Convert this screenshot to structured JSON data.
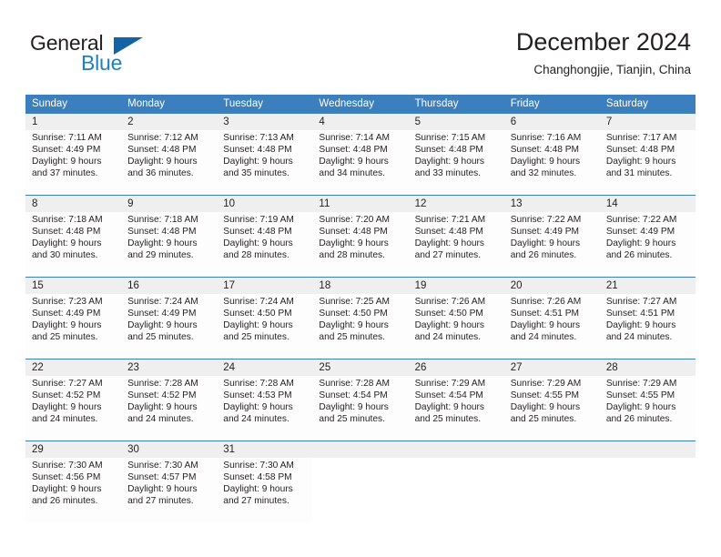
{
  "brand": {
    "name_part1": "General",
    "name_part2": "Blue"
  },
  "header": {
    "title": "December 2024",
    "location": "Changhongjie, Tianjin, China"
  },
  "colors": {
    "header_blue": "#3c7fbe",
    "brand_blue": "#1f7fc4",
    "logo_triangle": "#1464a5",
    "daynum_band": "#efefef",
    "text": "#231f20"
  },
  "weekday_headers": [
    "Sunday",
    "Monday",
    "Tuesday",
    "Wednesday",
    "Thursday",
    "Friday",
    "Saturday"
  ],
  "weeks": [
    {
      "days": [
        {
          "num": "1",
          "sunrise": "Sunrise: 7:11 AM",
          "sunset": "Sunset: 4:49 PM",
          "daylight1": "Daylight: 9 hours",
          "daylight2": "and 37 minutes."
        },
        {
          "num": "2",
          "sunrise": "Sunrise: 7:12 AM",
          "sunset": "Sunset: 4:48 PM",
          "daylight1": "Daylight: 9 hours",
          "daylight2": "and 36 minutes."
        },
        {
          "num": "3",
          "sunrise": "Sunrise: 7:13 AM",
          "sunset": "Sunset: 4:48 PM",
          "daylight1": "Daylight: 9 hours",
          "daylight2": "and 35 minutes."
        },
        {
          "num": "4",
          "sunrise": "Sunrise: 7:14 AM",
          "sunset": "Sunset: 4:48 PM",
          "daylight1": "Daylight: 9 hours",
          "daylight2": "and 34 minutes."
        },
        {
          "num": "5",
          "sunrise": "Sunrise: 7:15 AM",
          "sunset": "Sunset: 4:48 PM",
          "daylight1": "Daylight: 9 hours",
          "daylight2": "and 33 minutes."
        },
        {
          "num": "6",
          "sunrise": "Sunrise: 7:16 AM",
          "sunset": "Sunset: 4:48 PM",
          "daylight1": "Daylight: 9 hours",
          "daylight2": "and 32 minutes."
        },
        {
          "num": "7",
          "sunrise": "Sunrise: 7:17 AM",
          "sunset": "Sunset: 4:48 PM",
          "daylight1": "Daylight: 9 hours",
          "daylight2": "and 31 minutes."
        }
      ]
    },
    {
      "days": [
        {
          "num": "8",
          "sunrise": "Sunrise: 7:18 AM",
          "sunset": "Sunset: 4:48 PM",
          "daylight1": "Daylight: 9 hours",
          "daylight2": "and 30 minutes."
        },
        {
          "num": "9",
          "sunrise": "Sunrise: 7:18 AM",
          "sunset": "Sunset: 4:48 PM",
          "daylight1": "Daylight: 9 hours",
          "daylight2": "and 29 minutes."
        },
        {
          "num": "10",
          "sunrise": "Sunrise: 7:19 AM",
          "sunset": "Sunset: 4:48 PM",
          "daylight1": "Daylight: 9 hours",
          "daylight2": "and 28 minutes."
        },
        {
          "num": "11",
          "sunrise": "Sunrise: 7:20 AM",
          "sunset": "Sunset: 4:48 PM",
          "daylight1": "Daylight: 9 hours",
          "daylight2": "and 28 minutes."
        },
        {
          "num": "12",
          "sunrise": "Sunrise: 7:21 AM",
          "sunset": "Sunset: 4:48 PM",
          "daylight1": "Daylight: 9 hours",
          "daylight2": "and 27 minutes."
        },
        {
          "num": "13",
          "sunrise": "Sunrise: 7:22 AM",
          "sunset": "Sunset: 4:49 PM",
          "daylight1": "Daylight: 9 hours",
          "daylight2": "and 26 minutes."
        },
        {
          "num": "14",
          "sunrise": "Sunrise: 7:22 AM",
          "sunset": "Sunset: 4:49 PM",
          "daylight1": "Daylight: 9 hours",
          "daylight2": "and 26 minutes."
        }
      ]
    },
    {
      "days": [
        {
          "num": "15",
          "sunrise": "Sunrise: 7:23 AM",
          "sunset": "Sunset: 4:49 PM",
          "daylight1": "Daylight: 9 hours",
          "daylight2": "and 25 minutes."
        },
        {
          "num": "16",
          "sunrise": "Sunrise: 7:24 AM",
          "sunset": "Sunset: 4:49 PM",
          "daylight1": "Daylight: 9 hours",
          "daylight2": "and 25 minutes."
        },
        {
          "num": "17",
          "sunrise": "Sunrise: 7:24 AM",
          "sunset": "Sunset: 4:50 PM",
          "daylight1": "Daylight: 9 hours",
          "daylight2": "and 25 minutes."
        },
        {
          "num": "18",
          "sunrise": "Sunrise: 7:25 AM",
          "sunset": "Sunset: 4:50 PM",
          "daylight1": "Daylight: 9 hours",
          "daylight2": "and 25 minutes."
        },
        {
          "num": "19",
          "sunrise": "Sunrise: 7:26 AM",
          "sunset": "Sunset: 4:50 PM",
          "daylight1": "Daylight: 9 hours",
          "daylight2": "and 24 minutes."
        },
        {
          "num": "20",
          "sunrise": "Sunrise: 7:26 AM",
          "sunset": "Sunset: 4:51 PM",
          "daylight1": "Daylight: 9 hours",
          "daylight2": "and 24 minutes."
        },
        {
          "num": "21",
          "sunrise": "Sunrise: 7:27 AM",
          "sunset": "Sunset: 4:51 PM",
          "daylight1": "Daylight: 9 hours",
          "daylight2": "and 24 minutes."
        }
      ]
    },
    {
      "days": [
        {
          "num": "22",
          "sunrise": "Sunrise: 7:27 AM",
          "sunset": "Sunset: 4:52 PM",
          "daylight1": "Daylight: 9 hours",
          "daylight2": "and 24 minutes."
        },
        {
          "num": "23",
          "sunrise": "Sunrise: 7:28 AM",
          "sunset": "Sunset: 4:52 PM",
          "daylight1": "Daylight: 9 hours",
          "daylight2": "and 24 minutes."
        },
        {
          "num": "24",
          "sunrise": "Sunrise: 7:28 AM",
          "sunset": "Sunset: 4:53 PM",
          "daylight1": "Daylight: 9 hours",
          "daylight2": "and 24 minutes."
        },
        {
          "num": "25",
          "sunrise": "Sunrise: 7:28 AM",
          "sunset": "Sunset: 4:54 PM",
          "daylight1": "Daylight: 9 hours",
          "daylight2": "and 25 minutes."
        },
        {
          "num": "26",
          "sunrise": "Sunrise: 7:29 AM",
          "sunset": "Sunset: 4:54 PM",
          "daylight1": "Daylight: 9 hours",
          "daylight2": "and 25 minutes."
        },
        {
          "num": "27",
          "sunrise": "Sunrise: 7:29 AM",
          "sunset": "Sunset: 4:55 PM",
          "daylight1": "Daylight: 9 hours",
          "daylight2": "and 25 minutes."
        },
        {
          "num": "28",
          "sunrise": "Sunrise: 7:29 AM",
          "sunset": "Sunset: 4:55 PM",
          "daylight1": "Daylight: 9 hours",
          "daylight2": "and 26 minutes."
        }
      ]
    },
    {
      "days": [
        {
          "num": "29",
          "sunrise": "Sunrise: 7:30 AM",
          "sunset": "Sunset: 4:56 PM",
          "daylight1": "Daylight: 9 hours",
          "daylight2": "and 26 minutes."
        },
        {
          "num": "30",
          "sunrise": "Sunrise: 7:30 AM",
          "sunset": "Sunset: 4:57 PM",
          "daylight1": "Daylight: 9 hours",
          "daylight2": "and 27 minutes."
        },
        {
          "num": "31",
          "sunrise": "Sunrise: 7:30 AM",
          "sunset": "Sunset: 4:58 PM",
          "daylight1": "Daylight: 9 hours",
          "daylight2": "and 27 minutes."
        },
        {
          "num": "",
          "sunrise": "",
          "sunset": "",
          "daylight1": "",
          "daylight2": ""
        },
        {
          "num": "",
          "sunrise": "",
          "sunset": "",
          "daylight1": "",
          "daylight2": ""
        },
        {
          "num": "",
          "sunrise": "",
          "sunset": "",
          "daylight1": "",
          "daylight2": ""
        },
        {
          "num": "",
          "sunrise": "",
          "sunset": "",
          "daylight1": "",
          "daylight2": ""
        }
      ]
    }
  ]
}
